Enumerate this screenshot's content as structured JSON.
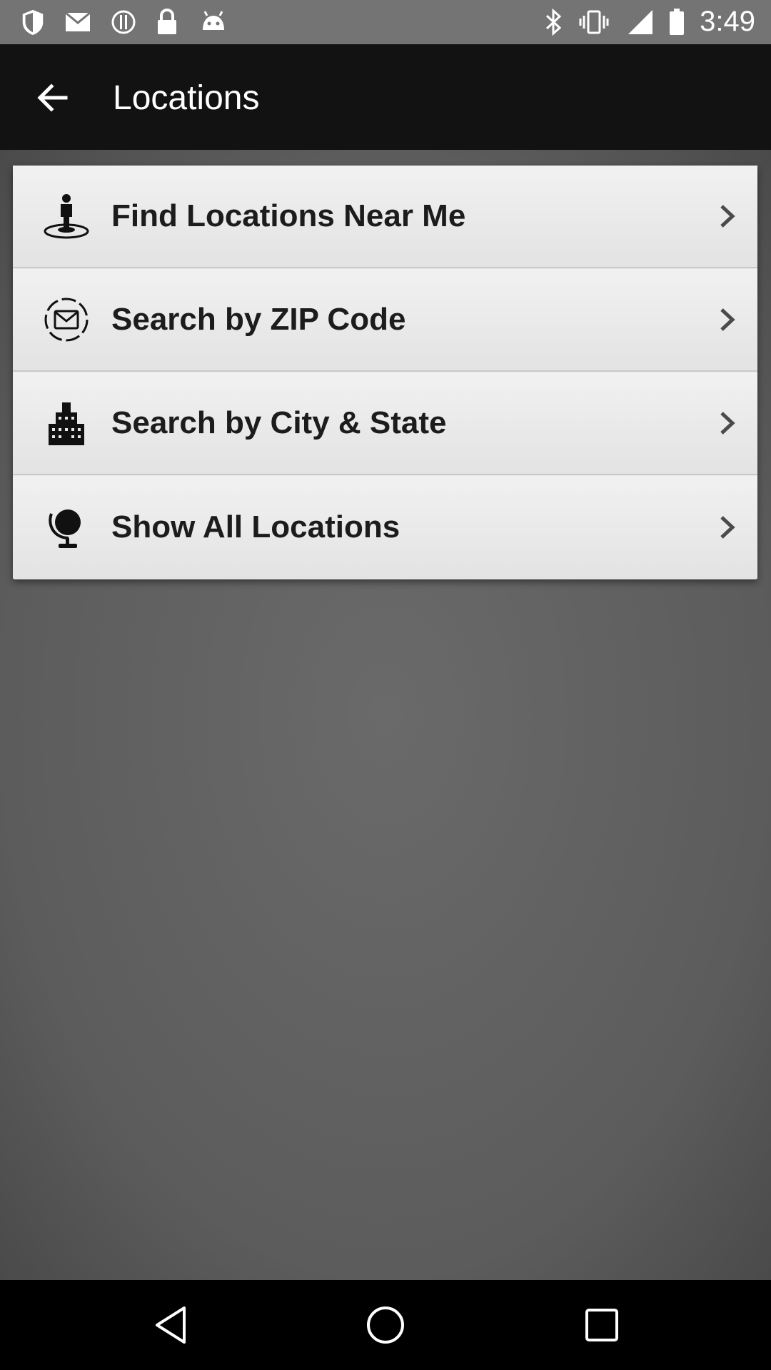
{
  "status_bar": {
    "time": "3:49",
    "left_icons": [
      "shield-icon",
      "mail-icon",
      "alert-icon",
      "lock-icon",
      "android-icon"
    ],
    "right_icons": [
      "bluetooth-icon",
      "vibrate-icon",
      "signal-icon",
      "battery-icon"
    ]
  },
  "app_bar": {
    "title": "Locations",
    "back_icon": "back-arrow-icon"
  },
  "menu": {
    "items": [
      {
        "label": "Find Locations Near Me",
        "icon": "person-pin-icon"
      },
      {
        "label": "Search by ZIP Code",
        "icon": "envelope-circle-icon"
      },
      {
        "label": "Search by City & State",
        "icon": "building-icon"
      },
      {
        "label": "Show All Locations",
        "icon": "globe-stand-icon"
      }
    ]
  },
  "nav_bar": {
    "buttons": [
      "back-triangle-icon",
      "home-circle-icon",
      "recents-square-icon"
    ]
  },
  "colors": {
    "app_bar": "#121212",
    "status_bar": "#747474",
    "card": "#e9e9e9",
    "background": "#5f5f5f"
  }
}
